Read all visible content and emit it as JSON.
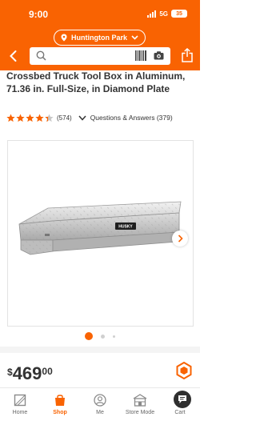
{
  "status": {
    "time": "9:00",
    "network": "5G",
    "battery": "35"
  },
  "header": {
    "store_name": "Huntington Park"
  },
  "product": {
    "title": "Crossbed Truck Tool Box in Aluminum, 71.36 in. Full-Size, in Diamond Plate",
    "rating": 4.2,
    "review_count": "(574)",
    "qa_label": "Questions & Answers (379)",
    "image_brand": "HUSKY"
  },
  "price": {
    "dollar_sign": "$",
    "whole": "469",
    "cents": "00"
  },
  "bottom_nav": {
    "home": "Home",
    "shop": "Shop",
    "me": "Me",
    "store_mode": "Store Mode",
    "cart": "Cart"
  },
  "colors": {
    "brand_orange": "#f96302",
    "text_dark": "#333333"
  },
  "icons": [
    "back-icon",
    "search-icon",
    "barcode-icon",
    "camera-icon",
    "share-icon",
    "location-pin-icon",
    "chevron-down-icon",
    "star-icon",
    "chevron-right-icon",
    "hexagon-icon",
    "chat-icon",
    "home-icon",
    "shop-icon",
    "person-icon",
    "store-icon",
    "cart-icon"
  ]
}
